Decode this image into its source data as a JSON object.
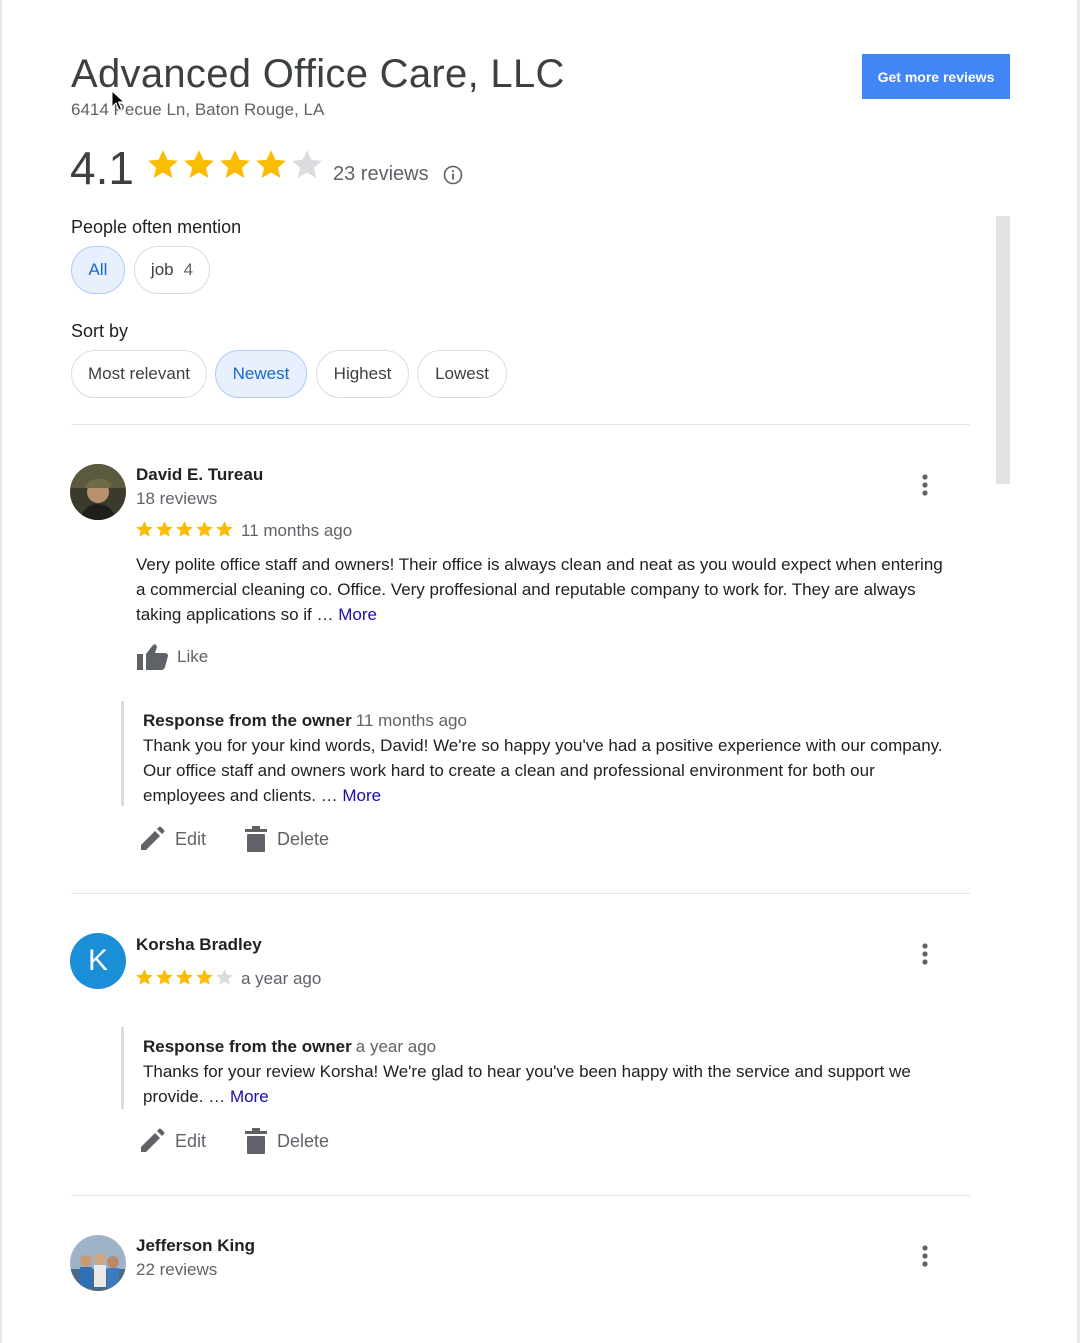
{
  "business": {
    "name": "Advanced Office Care, LLC",
    "address": "6414 Pecue Ln, Baton Rouge, LA",
    "get_more_label": "Get more reviews",
    "rating": "4.1",
    "rating_stars": 4.1,
    "reviews_count_label": "23 reviews"
  },
  "mentions": {
    "label": "People often mention",
    "chips": [
      {
        "label": "All",
        "count": ""
      },
      {
        "label": "job",
        "count": "4"
      }
    ]
  },
  "sort": {
    "label": "Sort by",
    "options": [
      "Most relevant",
      "Newest",
      "Highest",
      "Lowest"
    ],
    "selected": "Newest"
  },
  "colors": {
    "star": "#fbbc04",
    "star_empty": "#dadce0",
    "accent": "#4285f4",
    "avatar_k": "#1a8ed6"
  },
  "reviews": [
    {
      "name": "David E. Tureau",
      "sub": "18 reviews",
      "stars": 5,
      "time": "11 months ago",
      "text": "Very polite office staff and owners! Their office is always clean and neat as you would expect when entering a commercial cleaning co. Office. Very proffesional and reputable company to work for. They are always taking applications so if …",
      "more": "More",
      "like": "Like",
      "response": {
        "head": "Response from the owner",
        "time": "11 months ago",
        "text": "Thank you for your kind words, David! We're so happy you've had a positive experience with our company. Our office staff and owners work hard to create a clean and professional environment for both our employees and clients. …",
        "more": "More",
        "edit": "Edit",
        "delete": "Delete"
      }
    },
    {
      "name": "Korsha Bradley",
      "avatar_letter": "K",
      "stars": 4,
      "time": "a year ago",
      "response": {
        "head": "Response from the owner",
        "time": "a year ago",
        "text": "Thanks for your review Korsha! We're glad to hear you've been happy with the service and support we provide. …",
        "more": "More",
        "edit": "Edit",
        "delete": "Delete"
      }
    },
    {
      "name": "Jefferson King",
      "sub": "22 reviews"
    }
  ]
}
